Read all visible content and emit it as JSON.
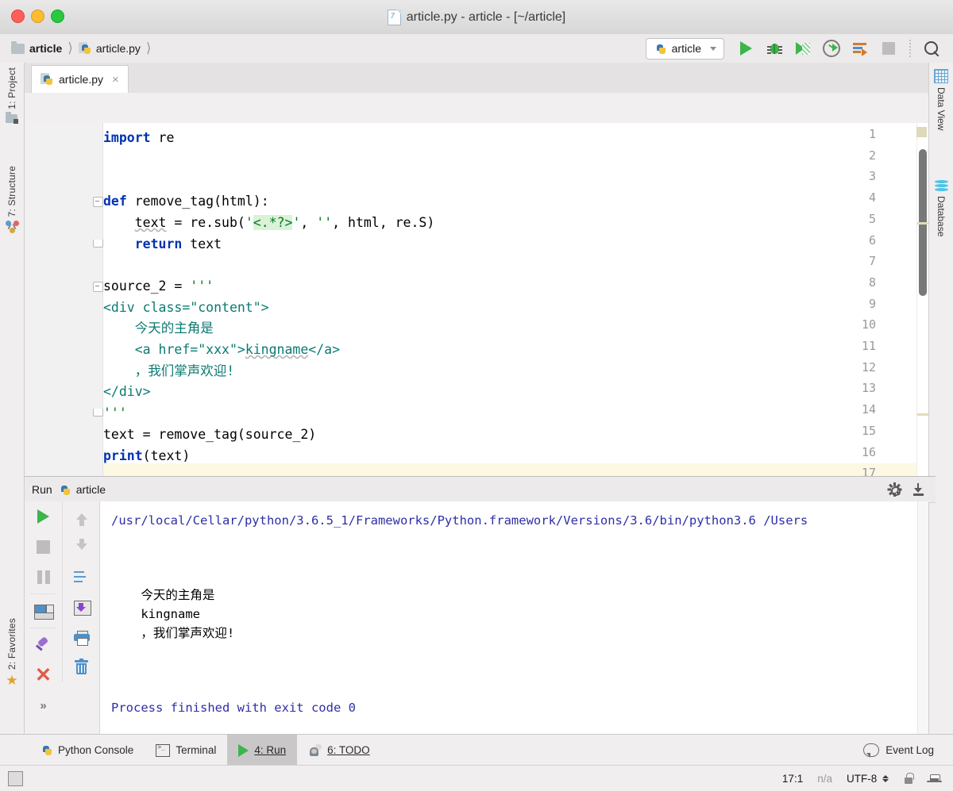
{
  "window": {
    "title": "article.py - article - [~/article]",
    "file_icon": "python-file-icon"
  },
  "navbar": {
    "breadcrumbs": [
      {
        "label": "article",
        "icon": "folder-icon"
      },
      {
        "label": "article.py",
        "icon": "python-file-icon"
      }
    ],
    "run_config": {
      "label": "article",
      "icon": "python-icon"
    },
    "buttons": [
      {
        "name": "run-button",
        "label": "Run"
      },
      {
        "name": "debug-button",
        "label": "Debug"
      },
      {
        "name": "run-coverage-button",
        "label": "Run with Coverage"
      },
      {
        "name": "profile-button",
        "label": "Profile"
      },
      {
        "name": "run-with-console-button",
        "label": "Run with Console"
      },
      {
        "name": "stop-button",
        "label": "Stop"
      },
      {
        "name": "search-everywhere-button",
        "label": "Search Everywhere"
      }
    ]
  },
  "left_stripe": {
    "items": [
      {
        "label": "1: Project",
        "icon": "project-icon"
      },
      {
        "label": "7: Structure",
        "icon": "structure-icon"
      },
      {
        "label": "2: Favorites",
        "icon": "star-icon"
      }
    ]
  },
  "right_stripe": {
    "items": [
      {
        "label": "Data View",
        "icon": "data-view-icon"
      },
      {
        "label": "Database",
        "icon": "database-icon"
      }
    ]
  },
  "editor": {
    "tab": {
      "label": "article.py",
      "icon": "python-file-icon",
      "close": "×"
    },
    "current_line": 17,
    "lines": [
      {
        "n": "1",
        "fold": "",
        "tokens": [
          {
            "t": "import",
            "c": "kw"
          },
          {
            "t": " re",
            "c": ""
          }
        ]
      },
      {
        "n": "2",
        "fold": "",
        "tokens": []
      },
      {
        "n": "3",
        "fold": "",
        "tokens": []
      },
      {
        "n": "4",
        "fold": "start",
        "tokens": [
          {
            "t": "def",
            "c": "kw"
          },
          {
            "t": " remove_tag(html):",
            "c": ""
          }
        ]
      },
      {
        "n": "5",
        "fold": "",
        "tokens": [
          {
            "t": "    ",
            "c": ""
          },
          {
            "t": "text",
            "c": "squig"
          },
          {
            "t": " = re.sub(",
            "c": ""
          },
          {
            "t": "'",
            "c": "strq"
          },
          {
            "t": "<.*?>",
            "c": "hl-green"
          },
          {
            "t": "'",
            "c": "strq"
          },
          {
            "t": ", ",
            "c": ""
          },
          {
            "t": "''",
            "c": "strq"
          },
          {
            "t": ", html, re.S)",
            "c": ""
          }
        ]
      },
      {
        "n": "6",
        "fold": "end",
        "tokens": [
          {
            "t": "    ",
            "c": ""
          },
          {
            "t": "return",
            "c": "kw"
          },
          {
            "t": " text",
            "c": ""
          }
        ]
      },
      {
        "n": "7",
        "fold": "",
        "tokens": []
      },
      {
        "n": "8",
        "fold": "start",
        "tokens": [
          {
            "t": "source_2 = ",
            "c": ""
          },
          {
            "t": "'''",
            "c": "strq"
          }
        ]
      },
      {
        "n": "9",
        "fold": "",
        "tokens": [
          {
            "t": "<div class=\"content\">",
            "c": "teal"
          }
        ]
      },
      {
        "n": "10",
        "fold": "",
        "tokens": [
          {
            "t": "    今天的主角是",
            "c": "teal"
          }
        ]
      },
      {
        "n": "11",
        "fold": "",
        "tokens": [
          {
            "t": "    <a href=\"xxx\">",
            "c": "teal"
          },
          {
            "t": "kingname",
            "c": "teal squig"
          },
          {
            "t": "</a>",
            "c": "teal"
          }
        ]
      },
      {
        "n": "12",
        "fold": "",
        "tokens": [
          {
            "t": "    ，我们掌声欢迎!",
            "c": "teal"
          }
        ]
      },
      {
        "n": "13",
        "fold": "",
        "tokens": [
          {
            "t": "</div>",
            "c": "teal"
          }
        ]
      },
      {
        "n": "14",
        "fold": "end",
        "tokens": [
          {
            "t": "'''",
            "c": "strq"
          }
        ]
      },
      {
        "n": "15",
        "fold": "",
        "tokens": [
          {
            "t": "text = remove_tag(source_2)",
            "c": ""
          }
        ]
      },
      {
        "n": "16",
        "fold": "",
        "tokens": [
          {
            "t": "print",
            "c": "kw"
          },
          {
            "t": "(text)",
            "c": ""
          }
        ]
      },
      {
        "n": "17",
        "fold": "",
        "tokens": []
      }
    ]
  },
  "run_panel": {
    "header": {
      "label": "Run",
      "config_name": "article",
      "icon": "python-icon"
    },
    "header_buttons": [
      {
        "name": "settings-gear-button",
        "label": "Settings"
      },
      {
        "name": "scroll-to-end-button",
        "label": "Scroll to end"
      }
    ],
    "side_buttons_left": [
      {
        "name": "rerun-button",
        "label": "Rerun"
      },
      {
        "name": "stop-process-button",
        "label": "Stop"
      },
      {
        "name": "pause-output-button",
        "label": "Pause Output"
      },
      {
        "name": "layout-settings-button",
        "label": "Layout Settings"
      },
      {
        "name": "pin-tab-button",
        "label": "Pin Tab"
      },
      {
        "name": "close-tab-button",
        "label": "Close"
      },
      {
        "name": "more-button",
        "label": "»"
      }
    ],
    "side_buttons_right": [
      {
        "name": "up-the-stack-trace-button",
        "label": "Up the Stack Trace"
      },
      {
        "name": "down-the-stack-trace-button",
        "label": "Down the Stack Trace"
      },
      {
        "name": "soft-wrap-button",
        "label": "Use Soft Wraps"
      },
      {
        "name": "export-button",
        "label": "Export to Text File"
      },
      {
        "name": "print-button",
        "label": "Print"
      },
      {
        "name": "clear-all-button",
        "label": "Clear All"
      }
    ],
    "console": {
      "command_line": "/usr/local/Cellar/python/3.6.5_1/Frameworks/Python.framework/Versions/3.6/bin/python3.6 /Users",
      "output": [
        "    今天的主角是",
        "    kingname",
        "    ，我们掌声欢迎!"
      ],
      "exit_message": "Process finished with exit code 0"
    }
  },
  "bottom_bar": {
    "items": [
      {
        "label": "Python Console",
        "icon": "python-icon",
        "active": false,
        "mnemonic": ""
      },
      {
        "label": "Terminal",
        "icon": "terminal-icon",
        "active": false,
        "mnemonic": ""
      },
      {
        "label": "4: Run",
        "icon": "run-icon",
        "active": true,
        "mnemonic": "4"
      },
      {
        "label": "6: TODO",
        "icon": "todo-icon",
        "active": false,
        "mnemonic": "6"
      }
    ],
    "event_log": {
      "label": "Event Log",
      "icon": "bubble-icon"
    }
  },
  "status_bar": {
    "caret_position": "17:1",
    "line_separator": "n/a",
    "encoding": "UTF-8",
    "lock_icon": "lock-icon",
    "inspection_icon": "hector-hat-icon"
  }
}
